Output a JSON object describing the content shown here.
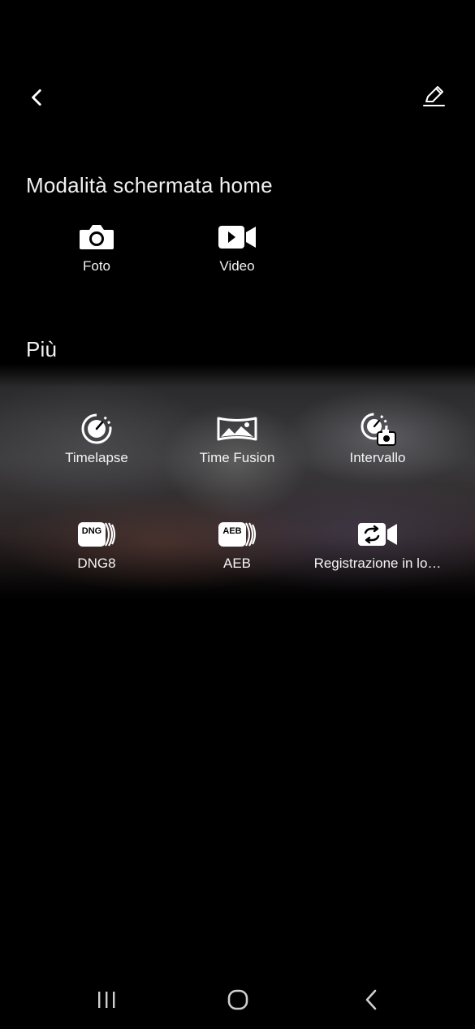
{
  "header": {
    "back_icon": "chevron-left-icon",
    "edit_icon": "pencil-icon"
  },
  "home_modes": {
    "title": "Modalità schermata home",
    "items": [
      {
        "label": "Foto",
        "icon": "camera-icon"
      },
      {
        "label": "Video",
        "icon": "video-camera-icon"
      }
    ]
  },
  "more": {
    "title": "Più",
    "items": [
      {
        "label": "Timelapse",
        "icon": "timelapse-icon"
      },
      {
        "label": "Time Fusion",
        "icon": "panorama-icon"
      },
      {
        "label": "Intervallo",
        "icon": "interval-camera-icon"
      },
      {
        "label": "DNG8",
        "icon": "dng-icon"
      },
      {
        "label": "AEB",
        "icon": "aeb-icon"
      },
      {
        "label": "Registrazione in lo…",
        "icon": "loop-recording-icon"
      }
    ]
  },
  "navbar": {
    "recents_icon": "recents-icon",
    "home_icon": "home-icon",
    "back_icon": "back-icon"
  }
}
